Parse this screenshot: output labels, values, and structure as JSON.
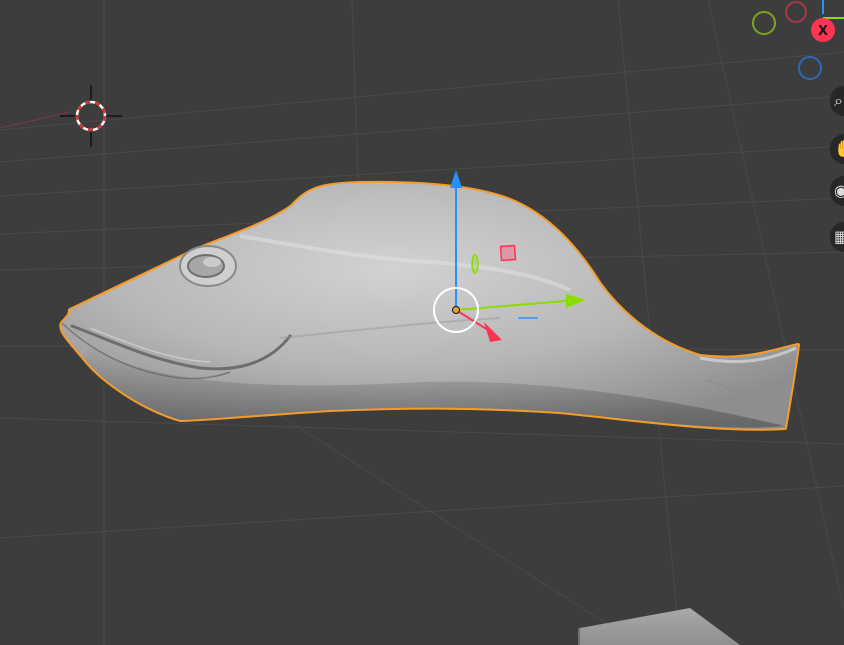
{
  "gizmo": {
    "x_label": "X",
    "colors": {
      "x": "#ff3352",
      "y": "#8bdc00",
      "z": "#2890ff"
    }
  },
  "object": {
    "outline_color": "#f39c2a",
    "material_color": "#b4b4b4"
  },
  "nav_buttons": [
    {
      "icon": "zoom-icon"
    },
    {
      "icon": "hand-pan-icon"
    },
    {
      "icon": "camera-icon"
    },
    {
      "icon": "grid-perspective-icon"
    }
  ]
}
